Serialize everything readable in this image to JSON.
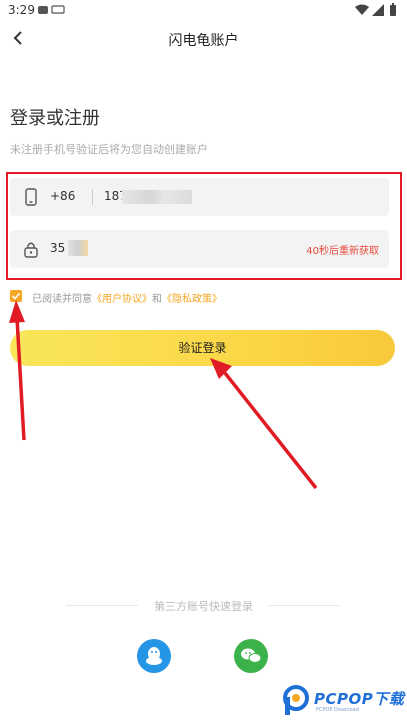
{
  "status": {
    "time": "3:29"
  },
  "nav": {
    "title": "闪电龟账户"
  },
  "heading": "登录或注册",
  "subtext": "未注册手机号验证后将为您自动创建账户",
  "phone": {
    "country_code": "+86",
    "value": "187"
  },
  "code": {
    "value": "35",
    "resend": "40秒后重新获取"
  },
  "agreement": {
    "prefix": "已阅读并同意",
    "user_agreement": "《用户协议》",
    "and": "和",
    "privacy_policy": "《隐私政策》",
    "checked": true
  },
  "login_button": "验证登录",
  "third_party": {
    "label": "第三方账号快速登录"
  },
  "watermark": {
    "brand": "PCPOP下载",
    "sub": "PCPOP Download"
  },
  "colors": {
    "accent": "#f5a623",
    "button": "#fbd747",
    "annotation": "#e01b24",
    "qq": "#2595e6",
    "wechat": "#3cb34a"
  }
}
